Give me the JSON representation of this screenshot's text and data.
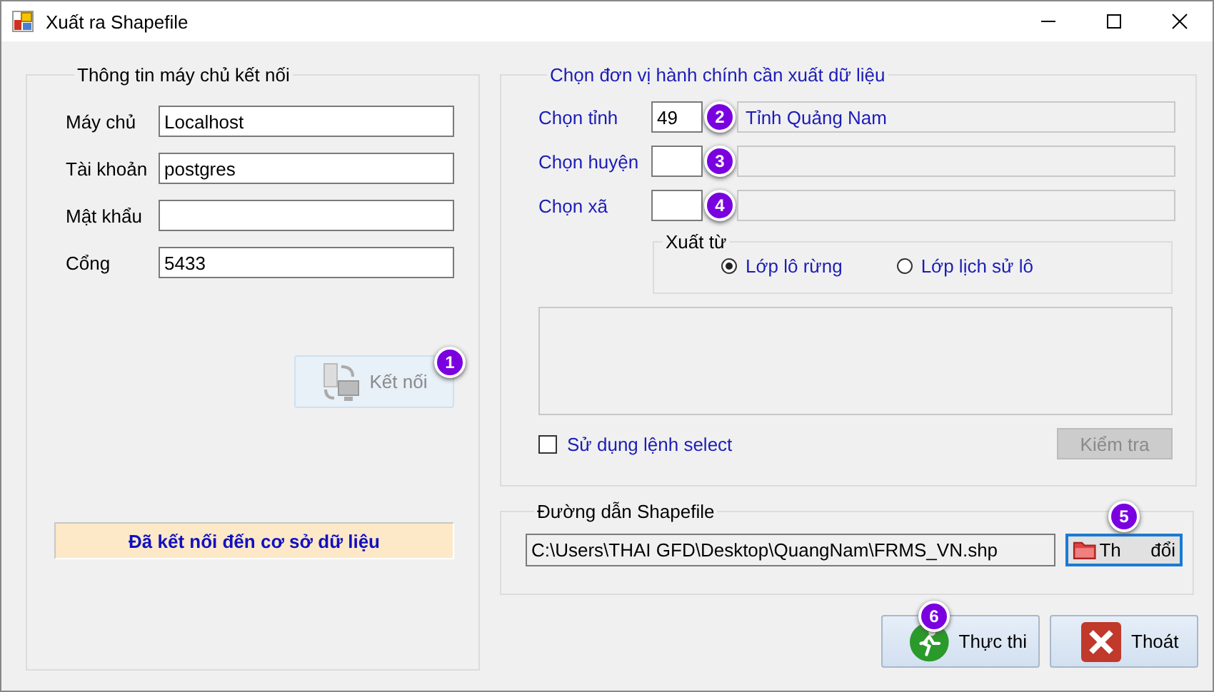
{
  "window": {
    "title": "Xuất ra Shapefile"
  },
  "connection": {
    "legend": "Thông tin máy chủ kết nối",
    "fields": [
      {
        "label": "Máy chủ",
        "value": "Localhost"
      },
      {
        "label": "Tài khoản",
        "value": "postgres"
      },
      {
        "label": "Mật khẩu"
      },
      {
        "label": "Cổng",
        "value": "5433"
      }
    ],
    "connect_button": {
      "label": "Kết nối",
      "disabled": true,
      "badge": "1"
    },
    "status": "Đã kết nối đến cơ sở dữ liệu"
  },
  "admin": {
    "legend": "Chọn đơn vị hành chính cần xuất dữ liệu",
    "rows": [
      {
        "label": "Chọn tỉnh",
        "code": "49",
        "name": "Tỉnh Quảng Nam",
        "badge": "2"
      },
      {
        "label": "Chọn huyện",
        "badge": "3"
      },
      {
        "label": "Chọn xã",
        "badge": "4"
      }
    ],
    "source": {
      "legend": "Xuất từ",
      "options": [
        {
          "label": "Lớp lô rừng",
          "selected": true
        },
        {
          "label": "Lớp lịch sử lô",
          "selected": false
        }
      ]
    },
    "use_select": {
      "label": "Sử dụng lệnh select",
      "checked": false
    },
    "check_button": {
      "label": "Kiểm tra",
      "disabled": true
    }
  },
  "path": {
    "legend": "Đường dẫn Shapefile",
    "value": "C:\\Users\\THAI GFD\\Desktop\\QuangNam\\FRMS_VN.shp",
    "change_button": {
      "label_parts": [
        "Th",
        "đổi"
      ],
      "badge": "5"
    }
  },
  "actions": [
    {
      "kind": "run",
      "label": "Thực thi",
      "badge": "6"
    },
    {
      "kind": "exit",
      "label": "Thoát"
    }
  ]
}
